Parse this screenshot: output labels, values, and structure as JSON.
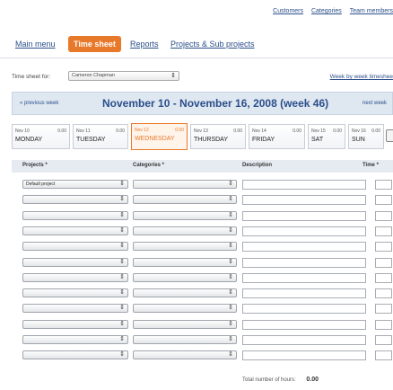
{
  "top_links": [
    "Customers",
    "Categories",
    "Team members"
  ],
  "nav": {
    "main_menu": "Main menu",
    "time_sheet": "Time sheet",
    "reports": "Reports",
    "projects": "Projects & Sub projects"
  },
  "timesheet_for": {
    "label": "Time sheet for:",
    "value": "Cameron Chapman",
    "week_link": "Week by week timeshee"
  },
  "week": {
    "prev": "« previous week",
    "title": "November 10 - November 16, 2008 (week 46)",
    "next": "next week"
  },
  "days": [
    {
      "date": "Nov 10",
      "hours": "0.00",
      "name": "MONDAY"
    },
    {
      "date": "Nov 11",
      "hours": "0.00",
      "name": "TUESDAY"
    },
    {
      "date": "Nov 12",
      "hours": "0.00",
      "name": "WEDNESDAY"
    },
    {
      "date": "Nov 13",
      "hours": "0.00",
      "name": "THURSDAY"
    },
    {
      "date": "Nov 14",
      "hours": "0.00",
      "name": "FRIDAY"
    },
    {
      "date": "Nov 15",
      "hours": "0.00",
      "name": "SAT"
    },
    {
      "date": "Nov 16",
      "hours": "0.00",
      "name": "SUN"
    }
  ],
  "active_day": "WEDNESDAY",
  "table": {
    "headers": {
      "projects": "Projects *",
      "categories": "Categories *",
      "description": "Description",
      "time": "Time *"
    },
    "rows": [
      {
        "project": "Default project",
        "category": ""
      },
      {
        "project": "",
        "category": ""
      },
      {
        "project": "",
        "category": ""
      },
      {
        "project": "",
        "category": ""
      },
      {
        "project": "",
        "category": ""
      },
      {
        "project": "",
        "category": ""
      },
      {
        "project": "",
        "category": ""
      },
      {
        "project": "",
        "category": ""
      },
      {
        "project": "",
        "category": ""
      },
      {
        "project": "",
        "category": ""
      },
      {
        "project": "",
        "category": ""
      },
      {
        "project": "",
        "category": ""
      }
    ]
  },
  "total": {
    "label": "Total number of hours:",
    "value": "0.00"
  },
  "colors": {
    "accent": "#e9792a",
    "link": "#2b4f8a",
    "header_bg": "#dfe7f1"
  }
}
